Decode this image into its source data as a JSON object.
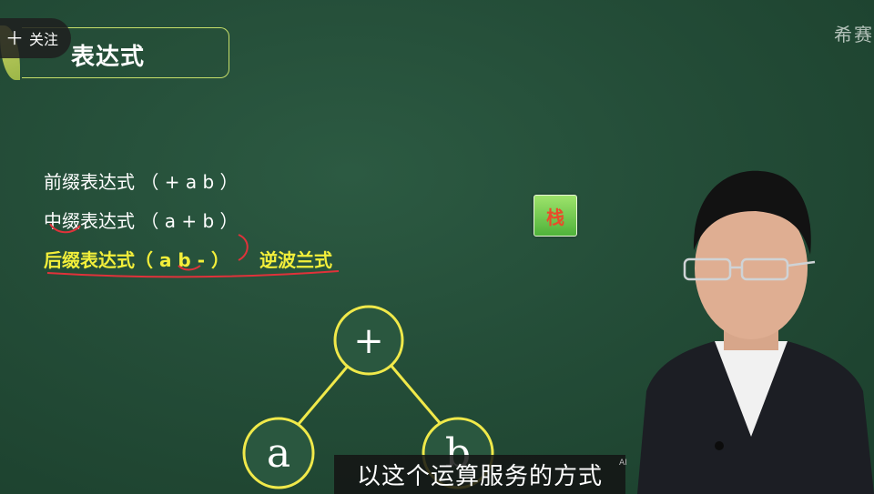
{
  "follow": {
    "label": "关注"
  },
  "title": "表达式",
  "watermark": "希赛",
  "expressions": {
    "prefix": "前缀表达式 （ + a b ）",
    "infix": "中缀表达式 （ a + b ）",
    "postfix": "后缀表达式（ a b - ）",
    "postfix_alias": "逆波兰式"
  },
  "stack_badge": "栈",
  "tree": {
    "root": "+",
    "left": "a",
    "right": "b"
  },
  "subtitle": "以这个运算服务的方式",
  "ai_tag": "AI",
  "colors": {
    "board": "#244d38",
    "highlight_text": "#f3ef3a",
    "node_stroke": "#f0e94a",
    "annotation_red": "#e0323a"
  }
}
